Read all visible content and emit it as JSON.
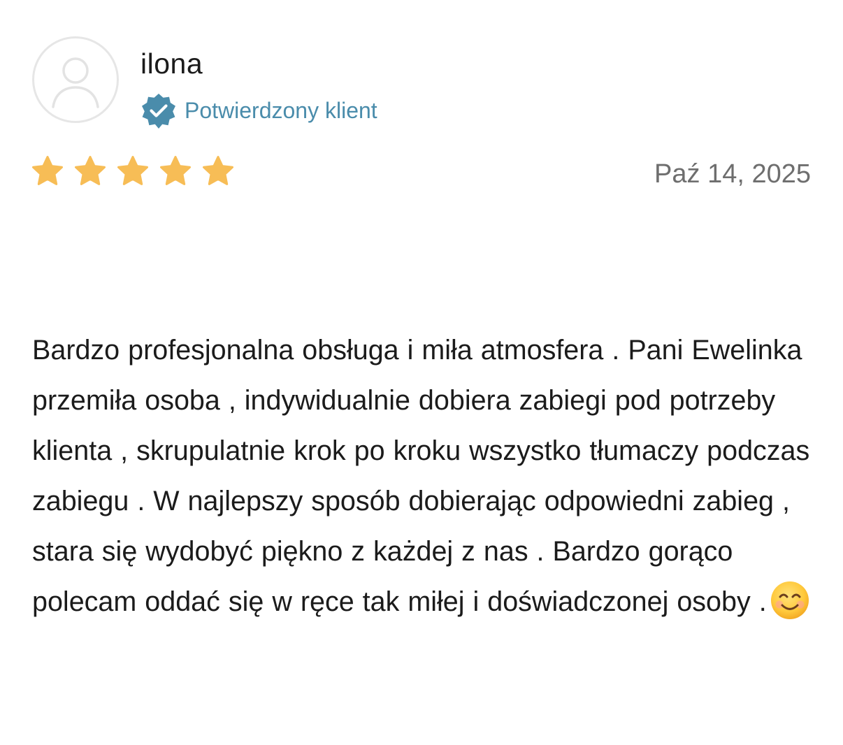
{
  "reviewer": {
    "name": "ilona",
    "avatar_icon": "user-placeholder-icon"
  },
  "verified": {
    "label": "Potwierdzony klient",
    "icon": "verified-badge-icon",
    "color": "#4a8cab"
  },
  "rating": {
    "stars": 5,
    "max": 5,
    "star_color": "#f7bd56"
  },
  "review": {
    "date": "Paź 14, 2025",
    "text": "Bardzo profesjonalna obsługa i miła atmosfera . Pani Ewelinka przemiła osoba , indywidualnie dobiera zabiegi pod potrzeby klienta , skrupulatnie krok po kroku wszystko tłumaczy podczas zabiegu . W najlepszy sposób dobierając odpowiedni zabieg , stara się wydobyć piękno z każdej z nas . Bardzo gorąco polecam oddać się w ręce tak miłej i doświadczonej osoby .",
    "trailing_emoji": "smiling-face-icon"
  }
}
